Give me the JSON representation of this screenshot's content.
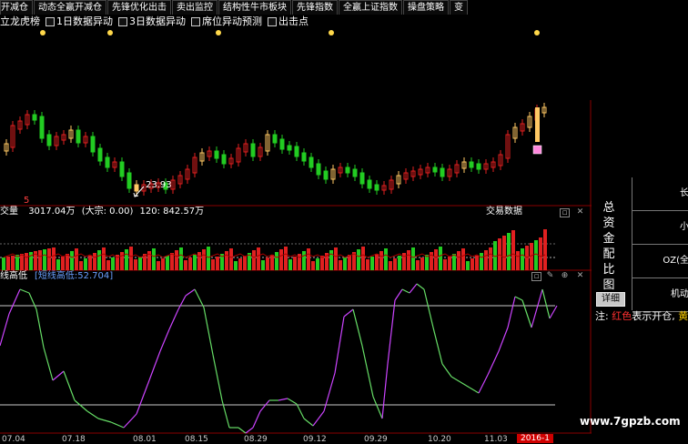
{
  "tabs": [
    "开减仓",
    "动态全赢开减仓",
    "先锋优化出击",
    "卖出监控",
    "结构性牛市板块",
    "先锋指数",
    "全赢上证指数",
    "操盘策略",
    "变"
  ],
  "toolbar": [
    {
      "label": "立龙虎榜",
      "checked": true
    },
    {
      "label": "1日数据异动",
      "checked": false
    },
    {
      "label": "3日数据异动",
      "checked": false
    },
    {
      "label": "席位异动预测",
      "checked": false
    },
    {
      "label": "出击点",
      "checked": false
    }
  ],
  "price_panel": {
    "low_marker": "23.93",
    "small_label": "5"
  },
  "volume_panel": {
    "header_prefix": "交量",
    "header_value": "3017.04万",
    "header_big": "(大宗: 0.00)",
    "header_ma": "120: 842.57万",
    "right_label": "交易数据"
  },
  "indicator_panel": {
    "title": "线高低",
    "value_label": "[短线高低:52.704]"
  },
  "side_panel": {
    "title_chars": [
      "总",
      "资",
      "金",
      "配",
      "比",
      "图"
    ],
    "detail_button": "详细",
    "rows": [
      "长",
      "小",
      "OZ(全",
      "机动"
    ],
    "note_prefix": "注: ",
    "note_red": "红色",
    "note_mid": "表示开仓, ",
    "note_yellow": "黄"
  },
  "x_axis": {
    "labels": [
      "07.04",
      "07.18",
      "08.01",
      "08.15",
      "08.29",
      "09.12",
      "09.29",
      "10.20",
      "11.03"
    ],
    "current_badge": "2016-1"
  },
  "watermark": "www.7gpzb.com",
  "colors": {
    "up": "#e02020",
    "down": "#22cc22",
    "gold": "#ffc864",
    "pink": "#ff66cc",
    "magenta": "#cc44ff",
    "bg": "#000000"
  }
}
